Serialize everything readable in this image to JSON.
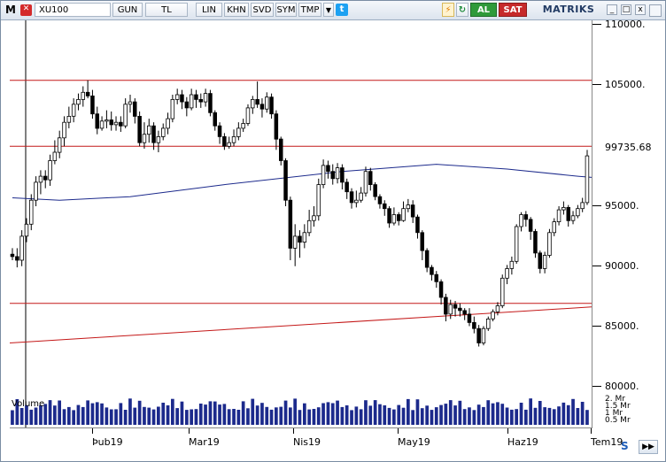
{
  "toolbar": {
    "logo": "M",
    "symbol": "XU100",
    "buttons": [
      "GUN",
      "TL",
      "LIN",
      "KHN",
      "SVD",
      "SYM",
      "TMP"
    ],
    "dropdown": "▼",
    "twitter": "t",
    "bolt": "⚡",
    "refresh": "↻",
    "buy_label": "AL",
    "sell_label": "SAT",
    "brand": "MATRIKS",
    "win_min": "_",
    "win_max": "□",
    "win_close": "x"
  },
  "colors": {
    "accent": "#213a63",
    "buy": "#2f9a3a",
    "sell": "#c62a2a",
    "line_red": "#c41818",
    "ma_blue": "#1c2a8c"
  },
  "y_axis": {
    "labels": [
      "110000.",
      "105000.",
      "99735.68",
      "95000.",
      "90000.",
      "85000.",
      "80000."
    ],
    "current_price": "99735.68"
  },
  "volume": {
    "label": "Volume",
    "axis_labels": [
      "2. Mr",
      "1.5 Mr",
      "1 Mr",
      "0.5 Mr"
    ]
  },
  "x_axis": {
    "labels": [
      "Þub19",
      "Mar19",
      "Nis19",
      "May19",
      "Haz19",
      "Tem19"
    ]
  },
  "chart_data": {
    "type": "candlestick",
    "symbol": "XU100",
    "ylim": [
      80000,
      111000
    ],
    "horizontal_lines": [
      106000,
      100500,
      87400
    ],
    "trend_line": {
      "from": 84100,
      "to": 87100
    },
    "candles": [
      [
        91500,
        91300,
        92000,
        91000
      ],
      [
        91300,
        91000,
        92000,
        90400
      ],
      [
        91000,
        93000,
        93500,
        90500
      ],
      [
        93000,
        94000,
        94500,
        92500
      ],
      [
        94000,
        96000,
        96500,
        93500
      ],
      [
        96000,
        97500,
        98000,
        95500
      ],
      [
        97500,
        98000,
        98500,
        96500
      ],
      [
        98000,
        97700,
        98500,
        97000
      ],
      [
        97700,
        99300,
        99800,
        97200
      ],
      [
        99300,
        100000,
        101000,
        99000
      ],
      [
        100000,
        101200,
        101800,
        99500
      ],
      [
        101200,
        102500,
        103000,
        100500
      ],
      [
        102500,
        103000,
        103800,
        102000
      ],
      [
        103000,
        104000,
        104500,
        102500
      ],
      [
        104000,
        104400,
        104900,
        103500
      ],
      [
        104400,
        105000,
        105500,
        103800
      ],
      [
        105000,
        104700,
        106000,
        104500
      ],
      [
        104700,
        103200,
        105200,
        102800
      ],
      [
        103200,
        102000,
        103800,
        101500
      ],
      [
        102000,
        102600,
        103000,
        101800
      ],
      [
        102600,
        102700,
        103500,
        102000
      ],
      [
        102700,
        102300,
        103400,
        101800
      ],
      [
        102300,
        102500,
        103000,
        101800
      ],
      [
        102500,
        102200,
        103000,
        101700
      ],
      [
        102200,
        104000,
        104500,
        102000
      ],
      [
        104000,
        104200,
        104800,
        103300
      ],
      [
        104200,
        103000,
        104500,
        102400
      ],
      [
        103000,
        100800,
        103400,
        100500
      ],
      [
        100800,
        101500,
        102500,
        100300
      ],
      [
        101500,
        102200,
        102800,
        100800
      ],
      [
        102200,
        100800,
        102500,
        100200
      ],
      [
        100800,
        101300,
        101800,
        100000
      ],
      [
        101300,
        102000,
        102400,
        101000
      ],
      [
        102000,
        102800,
        103300,
        101500
      ],
      [
        102800,
        104400,
        104800,
        102500
      ],
      [
        104400,
        104800,
        105300,
        104000
      ],
      [
        104800,
        104200,
        105200,
        103600
      ],
      [
        104200,
        103700,
        104600,
        103000
      ],
      [
        103700,
        104800,
        105300,
        103500
      ],
      [
        104800,
        104400,
        105200,
        103700
      ],
      [
        104400,
        104200,
        104900,
        103700
      ],
      [
        104200,
        104900,
        105300,
        103800
      ],
      [
        104900,
        103300,
        105200,
        103000
      ],
      [
        103300,
        102200,
        103500,
        101800
      ],
      [
        102200,
        101300,
        102500,
        100700
      ],
      [
        101300,
        100500,
        101600,
        100200
      ],
      [
        100500,
        100800,
        101300,
        100300
      ],
      [
        100800,
        101300,
        101900,
        100500
      ],
      [
        101300,
        102000,
        102500,
        101000
      ],
      [
        102000,
        102400,
        102800,
        101700
      ],
      [
        102400,
        103700,
        104000,
        102200
      ],
      [
        103700,
        104400,
        104700,
        103200
      ],
      [
        104400,
        104000,
        105900,
        103700
      ],
      [
        104000,
        103600,
        104500,
        102900
      ],
      [
        103600,
        104600,
        105000,
        103300
      ],
      [
        104600,
        103200,
        104900,
        102800
      ],
      [
        103200,
        101100,
        103500,
        100200
      ],
      [
        101100,
        99300,
        101300,
        98900
      ],
      [
        99300,
        96000,
        99500,
        95500
      ],
      [
        96000,
        92000,
        96300,
        91000
      ],
      [
        92000,
        93000,
        94000,
        90500
      ],
      [
        93000,
        92500,
        93500,
        91200
      ],
      [
        92500,
        93300,
        94000,
        92000
      ],
      [
        93300,
        94300,
        95200,
        93000
      ],
      [
        94300,
        94700,
        95500,
        93800
      ],
      [
        94700,
        97300,
        97800,
        94300
      ],
      [
        97300,
        98900,
        99400,
        97000
      ],
      [
        98900,
        98400,
        99300,
        97800
      ],
      [
        98400,
        97800,
        99000,
        97300
      ],
      [
        97800,
        98700,
        99100,
        97400
      ],
      [
        98700,
        97500,
        99000,
        96900
      ],
      [
        97500,
        96700,
        97800,
        96100
      ],
      [
        96700,
        95800,
        97000,
        95300
      ],
      [
        95800,
        96000,
        96800,
        95400
      ],
      [
        96000,
        96600,
        97100,
        95800
      ],
      [
        96600,
        98400,
        98800,
        96300
      ],
      [
        98400,
        97300,
        98700,
        96800
      ],
      [
        97300,
        96300,
        97500,
        96000
      ],
      [
        96300,
        95700,
        96500,
        95300
      ],
      [
        95700,
        95300,
        96000,
        94700
      ],
      [
        95300,
        94100,
        95500,
        93700
      ],
      [
        94100,
        94800,
        95400,
        93900
      ],
      [
        94800,
        94300,
        95000,
        93900
      ],
      [
        94300,
        95300,
        95900,
        94200
      ],
      [
        95300,
        95600,
        96100,
        95000
      ],
      [
        95600,
        94600,
        96000,
        94100
      ],
      [
        94600,
        93300,
        94800,
        92800
      ],
      [
        93300,
        91800,
        93500,
        91000
      ],
      [
        91800,
        90400,
        92000,
        90000
      ],
      [
        90400,
        89800,
        90600,
        89300
      ],
      [
        89800,
        89200,
        90100,
        88700
      ],
      [
        89200,
        87900,
        89400,
        87300
      ],
      [
        87900,
        86500,
        88200,
        85900
      ],
      [
        86500,
        87300,
        87700,
        86100
      ],
      [
        87300,
        87000,
        87600,
        86300
      ],
      [
        87000,
        86800,
        87400,
        86300
      ],
      [
        86800,
        86500,
        87000,
        86000
      ],
      [
        86500,
        85800,
        87000,
        85500
      ],
      [
        85800,
        85300,
        86300,
        84900
      ],
      [
        85300,
        84100,
        85600,
        83800
      ],
      [
        84100,
        85300,
        85500,
        83900
      ],
      [
        85300,
        86100,
        86300,
        85100
      ],
      [
        86100,
        86700,
        86900,
        85900
      ],
      [
        86700,
        87200,
        87500,
        86400
      ],
      [
        87200,
        89500,
        89800,
        87000
      ],
      [
        89500,
        90300,
        90600,
        89000
      ],
      [
        90300,
        90900,
        91300,
        89800
      ],
      [
        90900,
        93800,
        94000,
        90700
      ],
      [
        93800,
        94800,
        95000,
        93400
      ],
      [
        94800,
        94400,
        95100,
        93800
      ],
      [
        94400,
        93400,
        94600,
        92700
      ],
      [
        93400,
        91600,
        93600,
        91200
      ],
      [
        91600,
        90300,
        91800,
        89900
      ],
      [
        90300,
        91400,
        91700,
        89900
      ],
      [
        91400,
        93300,
        93600,
        91200
      ],
      [
        93300,
        94200,
        94500,
        93000
      ],
      [
        94200,
        95200,
        95500,
        93900
      ],
      [
        95200,
        95400,
        95900,
        94800
      ],
      [
        95400,
        94300,
        95600,
        93800
      ],
      [
        94300,
        94700,
        95100,
        94000
      ],
      [
        94700,
        95300,
        95600,
        94500
      ],
      [
        95300,
        95800,
        96200,
        95000
      ],
      [
        95800,
        99700,
        100200,
        95600
      ]
    ],
    "ma": [
      [
        0,
        96200
      ],
      [
        10,
        96000
      ],
      [
        25,
        96300
      ],
      [
        45,
        97300
      ],
      [
        70,
        98400
      ],
      [
        90,
        99000
      ],
      [
        105,
        98600
      ],
      [
        120,
        98000
      ],
      [
        135,
        97500
      ],
      [
        150,
        96500
      ],
      [
        165,
        95800
      ],
      [
        178,
        95600
      ],
      [
        185,
        95700
      ]
    ],
    "volume_unit": "Mr",
    "volume_ylim": [
      0,
      2.2
    ]
  }
}
